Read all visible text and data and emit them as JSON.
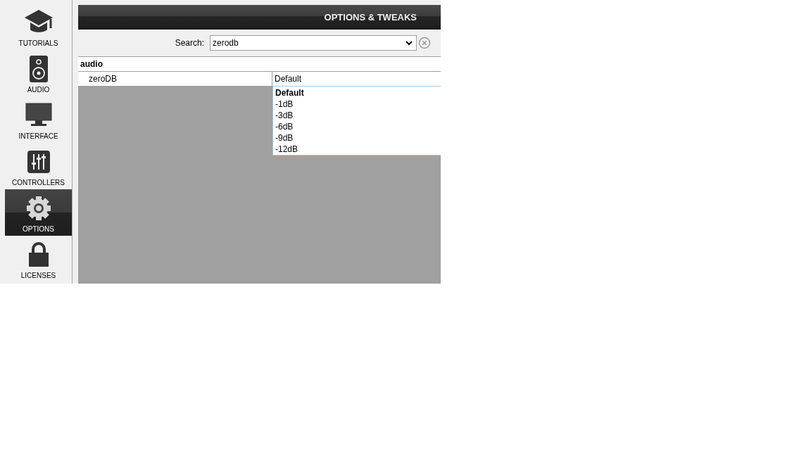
{
  "sidebar": {
    "items": [
      {
        "kind": "tutorials",
        "label": "TUTORIALS",
        "selected": false
      },
      {
        "kind": "audio",
        "label": "AUDIO",
        "selected": false
      },
      {
        "kind": "interface",
        "label": "INTERFACE",
        "selected": false
      },
      {
        "kind": "controllers",
        "label": "CONTROLLERS",
        "selected": false
      },
      {
        "kind": "options",
        "label": "OPTIONS",
        "selected": true
      },
      {
        "kind": "licenses",
        "label": "LICENSES",
        "selected": false
      }
    ]
  },
  "header": {
    "title": "OPTIONS & TWEAKS"
  },
  "search": {
    "label": "Search:",
    "value": "zerodb"
  },
  "table": {
    "groups": [
      {
        "name": "audio",
        "rows": [
          {
            "name": "zeroDB",
            "value": "Default"
          }
        ]
      }
    ]
  },
  "dropdown": {
    "options": [
      {
        "label": "Default",
        "selected": true
      },
      {
        "label": "-1dB",
        "selected": false
      },
      {
        "label": "-3dB",
        "selected": false
      },
      {
        "label": "-6dB",
        "selected": false
      },
      {
        "label": "-9dB",
        "selected": false
      },
      {
        "label": "-12dB",
        "selected": false
      }
    ]
  }
}
